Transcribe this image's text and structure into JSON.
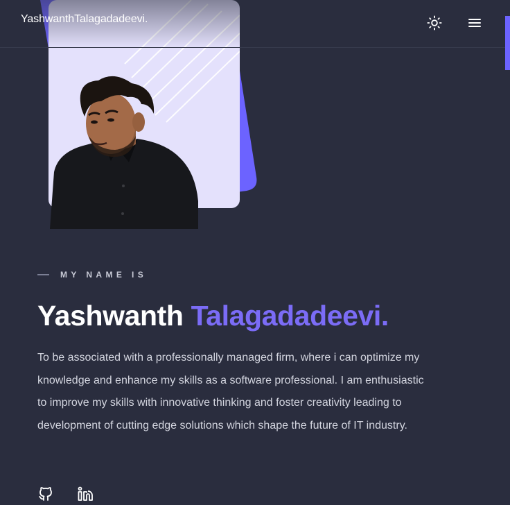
{
  "header": {
    "brand": "YashwanthTalagadadeevi.",
    "theme_toggle_icon": "sun-icon",
    "menu_icon": "hamburger-menu-icon"
  },
  "hero": {
    "portrait_alt": "Portrait photo of Yashwanth Talagadadeevi"
  },
  "intro": {
    "eyebrow": "MY NAME IS",
    "first_name": "Yashwanth",
    "last_name": "Talagadadeevi.",
    "bio": "To be associated with a professionally managed firm, where i can optimize my knowledge and enhance my skills as a software professional. I am enthusiastic to improve my skills with innovative thinking and foster creativity leading to development of cutting edge solutions which shape the future of IT industry."
  },
  "socials": [
    {
      "icon": "github-icon"
    },
    {
      "icon": "linkedin-icon"
    }
  ],
  "colors": {
    "background": "#2a2d3e",
    "accent": "#6c63ff",
    "accent_text": "#7b6cf6",
    "card": "#e4e1fc"
  }
}
